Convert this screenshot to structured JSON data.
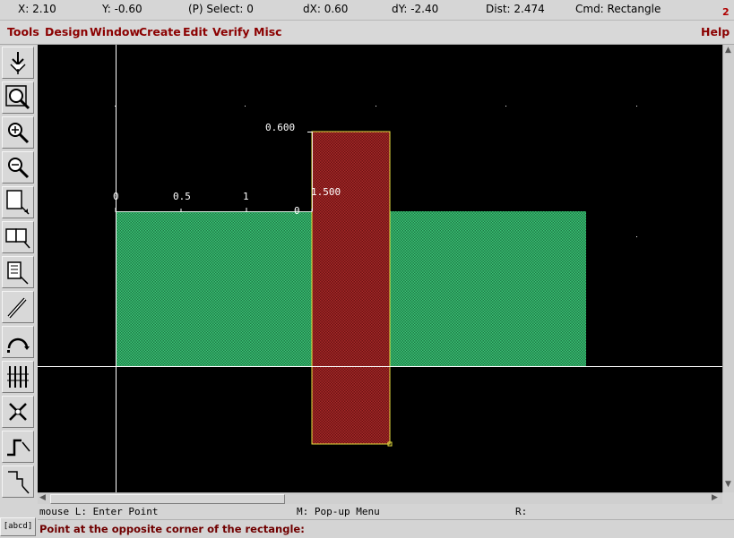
{
  "status": {
    "x": "X: 2.10",
    "y": "Y: -0.60",
    "select": "(P) Select: 0",
    "dx": "dX: 0.60",
    "dy": "dY: -2.40",
    "dist": "Dist: 2.474",
    "cmd": "Cmd: Rectangle",
    "window_number": "2"
  },
  "menu": {
    "items": [
      "Tools",
      "Design",
      "Window",
      "Create",
      "Edit",
      "Verify",
      "Misc"
    ],
    "help": "Help"
  },
  "toolbar": {
    "tools": [
      "select-arrows-icon",
      "zoom-fit-icon",
      "zoom-in-icon",
      "zoom-out-icon",
      "rectangle-select-icon",
      "two-box-icon",
      "stack-box-icon",
      "probe-pen-icon",
      "arc-icon",
      "grid-lines-icon",
      "move-cross-icon",
      "wire-step-icon",
      "polygon-icon"
    ]
  },
  "canvas": {
    "labels": {
      "top_value": "0.600",
      "x0": "0",
      "x05": "0.5",
      "x1": "1",
      "x15": "1.500",
      "y0": "0"
    },
    "colors": {
      "green_shape": "#2aa05a",
      "red_shape": "#8a1a1a",
      "outline": "#e8e040",
      "axis": "#ffffff"
    }
  },
  "mouse": {
    "left": "mouse L: Enter Point",
    "middle": "M: Pop-up Menu",
    "right": "R:"
  },
  "prompt": "Point at the opposite corner of the rectangle:",
  "abcd": "[abcd]"
}
